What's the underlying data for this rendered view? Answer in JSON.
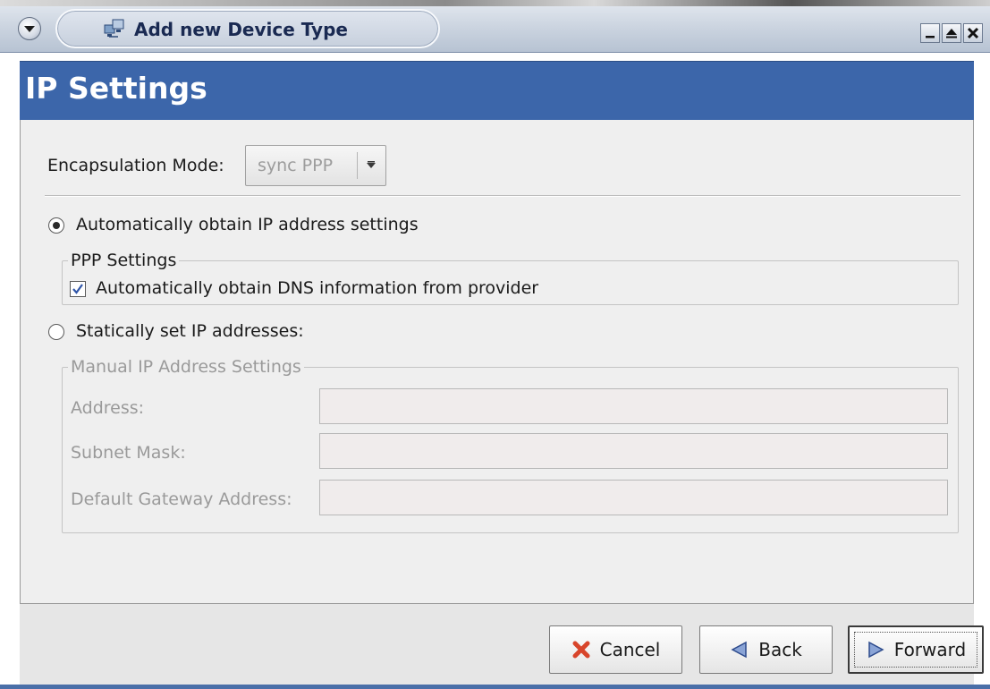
{
  "window": {
    "title": "Add new Device Type",
    "icons": {
      "menu": "window-menu-icon",
      "app": "network-device-icon",
      "minimize": "minimize-icon",
      "maximize": "maximize-icon",
      "close": "close-icon"
    }
  },
  "banner": {
    "title": "IP Settings",
    "color": "#3c66aa"
  },
  "encapsulation": {
    "label": "Encapsulation Mode:",
    "selected": "sync PPP"
  },
  "auto_ip": {
    "label": "Automatically obtain IP address settings",
    "checked": true
  },
  "ppp_settings": {
    "legend": "PPP Settings",
    "auto_dns_label": "Automatically obtain DNS information from provider",
    "auto_dns_checked": true
  },
  "static_ip": {
    "label": "Statically set IP addresses:",
    "checked": false
  },
  "manual_ip": {
    "legend": "Manual IP Address Settings",
    "address_label": "Address:",
    "address_value": "",
    "subnet_label": "Subnet Mask:",
    "subnet_value": "",
    "gateway_label": "Default Gateway Address:",
    "gateway_value": ""
  },
  "buttons": {
    "cancel": "Cancel",
    "back": "Back",
    "forward": "Forward"
  }
}
